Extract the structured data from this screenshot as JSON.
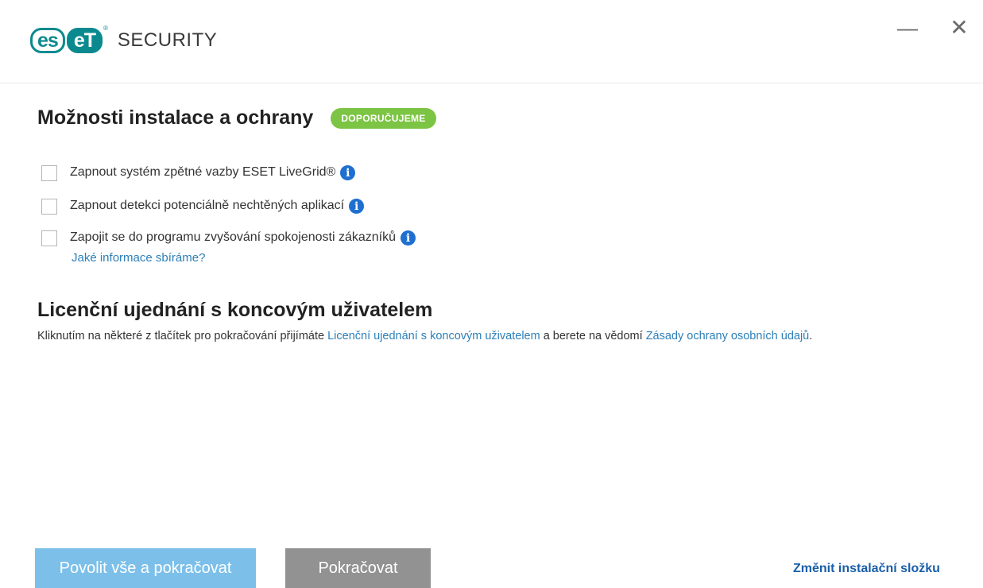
{
  "header": {
    "logo_text_left": "es",
    "logo_text_right": "eT",
    "logo_mark": "®",
    "app_name": "SECURITY",
    "minimize_icon": "—",
    "close_icon": "✕"
  },
  "section_options": {
    "title": "Možnosti instalace a ochrany",
    "badge": "DOPORUČUJEME",
    "items": [
      {
        "label": "Zapnout systém zpětné vazby ESET LiveGrid®",
        "checked": false
      },
      {
        "label": "Zapnout detekci potenciálně nechtěných aplikací",
        "checked": false
      },
      {
        "label": "Zapojit se do programu zvyšování spokojenosti zákazníků",
        "checked": false
      }
    ],
    "info_glyph": "i",
    "sub_link": "Jaké informace sbíráme?"
  },
  "section_eula": {
    "title": "Licenční ujednání s koncovým uživatelem",
    "text_1": "Kliknutím na některé z tlačítek pro pokračování přijímáte ",
    "link_eula": "Licenční ujednání s koncovým uživatelem",
    "text_2": " a berete na vědomí ",
    "link_privacy": "Zásady ochrany osobních údajů",
    "text_3": "."
  },
  "footer": {
    "primary_button": "Povolit vše a pokračovat",
    "secondary_button": "Pokračovat",
    "change_folder_link": "Změnit instalační složku"
  },
  "colors": {
    "brand": "#0a8a8f",
    "badge": "#7cc443",
    "link": "#2c7fb8",
    "primary_button": "#7cc0ea",
    "secondary_button": "#929292",
    "info_icon": "#1e6fcf"
  }
}
